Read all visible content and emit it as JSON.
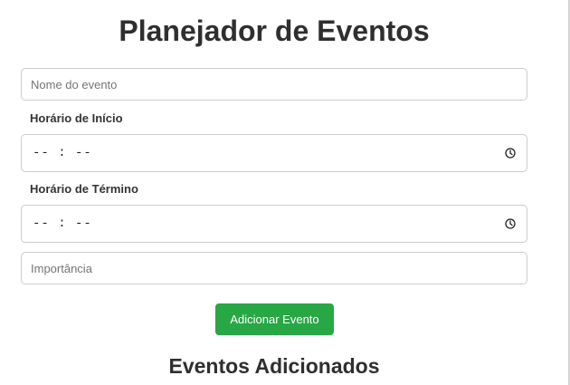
{
  "page": {
    "title": "Planejador de Eventos"
  },
  "form": {
    "event_name": {
      "placeholder": "Nome do evento",
      "value": ""
    },
    "start_time": {
      "label": "Horário de Início",
      "display": "-- : --",
      "icon": "clock-icon"
    },
    "end_time": {
      "label": "Horário de Término",
      "display": "-- : --",
      "icon": "clock-icon"
    },
    "importance": {
      "placeholder": "Importância",
      "value": ""
    },
    "add_button_label": "Adicionar Evento"
  },
  "events_section": {
    "title": "Eventos Adicionados"
  },
  "colors": {
    "accent": "#28a745",
    "title_text": "#2f2f2f",
    "border": "#cccccc"
  }
}
